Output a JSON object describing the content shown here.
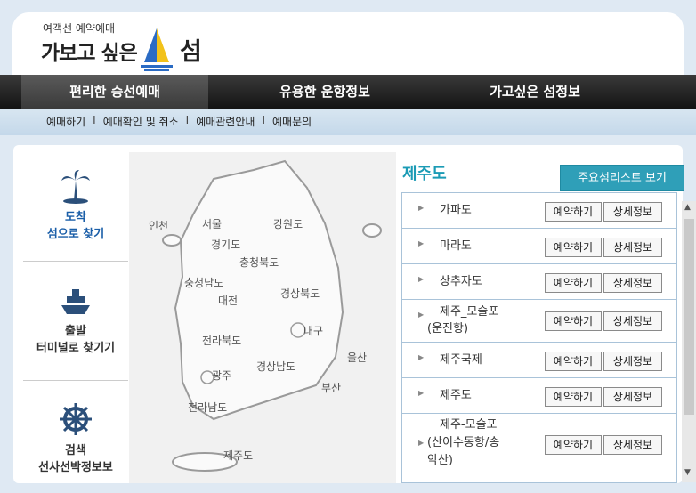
{
  "logo": {
    "small": "여객선 예약예매",
    "big": "가보고 싶은",
    "suffix": "섬"
  },
  "nav": {
    "items": [
      "편리한 승선예매",
      "유용한 운항정보",
      "가고싶은 섬정보"
    ]
  },
  "subnav": {
    "items": [
      "예매하기",
      "예매확인 및 취소",
      "예매관련안내",
      "예매문의"
    ],
    "separator": "I"
  },
  "sidebar": {
    "items": [
      {
        "line1": "도착",
        "line2": "섬으로 찾기",
        "icon": "palm-tree-icon",
        "active": true
      },
      {
        "line1": "출발",
        "line2": "터미널로 찾기기",
        "icon": "ship-icon",
        "active": false
      },
      {
        "line1": "검색",
        "line2": "선사선박정보보",
        "icon": "helm-icon",
        "active": false
      }
    ]
  },
  "map": {
    "labels": [
      "인천",
      "서울",
      "강원도",
      "경기도",
      "충청북도",
      "충청남도",
      "대전",
      "경상북도",
      "대구",
      "전라북도",
      "울산",
      "광주",
      "경상남도",
      "부산",
      "전라남도",
      "제주도"
    ]
  },
  "region": {
    "title": "제주도"
  },
  "list_button": "주요섬리스트 보기",
  "islands": [
    {
      "name": "가파도",
      "reserve": "예약하기",
      "detail": "상세정보"
    },
    {
      "name": "마라도",
      "reserve": "예약하기",
      "detail": "상세정보"
    },
    {
      "name": "상추자도",
      "reserve": "예약하기",
      "detail": "상세정보"
    },
    {
      "name_line1": "제주_모슬포",
      "name_line2": "(운진항)",
      "reserve": "예약하기",
      "detail": "상세정보"
    },
    {
      "name": "제주국제",
      "reserve": "예약하기",
      "detail": "상세정보"
    },
    {
      "name": "제주도",
      "reserve": "예약하기",
      "detail": "상세정보"
    },
    {
      "name_line1": "제주-모슬포",
      "name_line2": "(산이수동항/송",
      "name_line3": "악산)",
      "reserve": "예약하기",
      "detail": "상세정보"
    }
  ],
  "colors": {
    "accent": "#1b9bb5",
    "active_side": "#1a5ea8",
    "nav_bg": "#1e1e1e"
  }
}
